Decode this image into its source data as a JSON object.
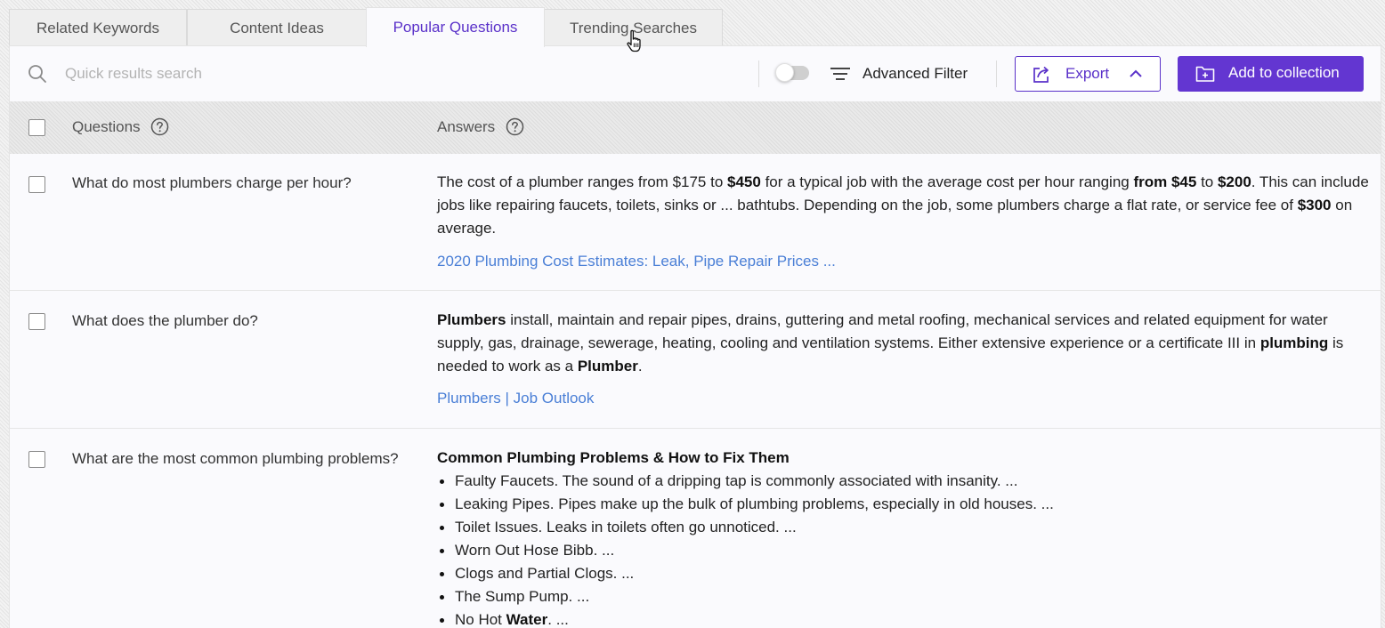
{
  "tabs": [
    {
      "label": "Related Keywords",
      "active": false
    },
    {
      "label": "Content Ideas",
      "active": false
    },
    {
      "label": "Popular Questions",
      "active": true
    },
    {
      "label": "Trending Searches",
      "active": false
    }
  ],
  "toolbar": {
    "search_placeholder": "Quick results search",
    "search_value": "",
    "toggle_on": false,
    "advanced_filter_label": "Advanced Filter",
    "export_label": "Export",
    "add_to_collection_label": "Add to collection"
  },
  "table": {
    "headers": {
      "questions": "Questions",
      "answers": "Answers"
    },
    "rows": [
      {
        "question": "What do most plumbers charge per hour?",
        "answer_segments": [
          {
            "t": "The cost of a plumber ranges from $175 to ",
            "b": false
          },
          {
            "t": "$450",
            "b": true
          },
          {
            "t": " for a typical job with the average cost per hour ranging ",
            "b": false
          },
          {
            "t": "from $45",
            "b": true
          },
          {
            "t": " to ",
            "b": false
          },
          {
            "t": "$200",
            "b": true
          },
          {
            "t": ". This can include jobs like repairing faucets, toilets, sinks or ... bathtubs. Depending on the job, some plumbers charge a flat rate, or service fee of ",
            "b": false
          },
          {
            "t": "$300",
            "b": true
          },
          {
            "t": " on average.",
            "b": false
          }
        ],
        "source": "2020 Plumbing Cost Estimates: Leak, Pipe Repair Prices ..."
      },
      {
        "question": "What does the plumber do?",
        "answer_segments": [
          {
            "t": "Plumbers",
            "b": true
          },
          {
            "t": " install, maintain and repair pipes, drains, guttering and metal roofing, mechanical services and related equipment for water supply, gas, drainage, sewerage, heating, cooling and ventilation systems. Either extensive experience or a certificate III in ",
            "b": false
          },
          {
            "t": "plumbing",
            "b": true
          },
          {
            "t": " is needed to work as a ",
            "b": false
          },
          {
            "t": "Plumber",
            "b": true
          },
          {
            "t": ".",
            "b": false
          }
        ],
        "source": "Plumbers | Job Outlook"
      },
      {
        "question": "What are the most common plumbing problems?",
        "list_title": "Common Plumbing Problems & How to Fix Them",
        "list_items": [
          [
            {
              "t": "Faulty Faucets. The sound of a dripping tap is commonly associated with insanity. ...",
              "b": false
            }
          ],
          [
            {
              "t": "Leaking Pipes. Pipes make up the bulk of plumbing problems, especially in old houses. ...",
              "b": false
            }
          ],
          [
            {
              "t": "Toilet Issues. Leaks in toilets often go unnoticed. ...",
              "b": false
            }
          ],
          [
            {
              "t": "Worn Out Hose Bibb. ...",
              "b": false
            }
          ],
          [
            {
              "t": "Clogs and Partial Clogs. ...",
              "b": false
            }
          ],
          [
            {
              "t": "The Sump Pump. ...",
              "b": false
            }
          ],
          [
            {
              "t": "No Hot ",
              "b": false
            },
            {
              "t": "Water",
              "b": true
            },
            {
              "t": ". ...",
              "b": false
            }
          ]
        ]
      }
    ]
  },
  "colors": {
    "accent": "#6336d1",
    "link": "#4a7fd6",
    "active_tab_text": "#5a31c9"
  },
  "icons": [
    "search-icon",
    "filter-icon",
    "export-icon",
    "chevron-up-icon",
    "folder-plus-icon",
    "help-icon",
    "hand-cursor-icon"
  ]
}
